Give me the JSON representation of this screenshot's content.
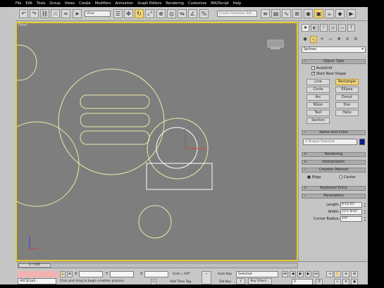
{
  "menu": {
    "items": [
      "File",
      "Edit",
      "Tools",
      "Group",
      "Views",
      "Create",
      "Modifiers",
      "Animation",
      "Graph Editors",
      "Rendering",
      "Customize",
      "MAXScript",
      "Help"
    ]
  },
  "toolbar": {
    "filter_select": "View",
    "selection_set_placeholder": "Create Selection Set"
  },
  "viewport": {
    "label": "Front",
    "border_color": "#e7cc2c",
    "shape_color": "#efe8a8",
    "selected_color": "#ffffff"
  },
  "command_panel": {
    "tabs": [
      "create-icon",
      "modify-icon",
      "hierarchy-icon",
      "motion-icon",
      "display-icon",
      "utilities-icon"
    ],
    "category_dropdown": "Splines",
    "object_type": {
      "title": "Object Type",
      "autogrid": "AutoGrid",
      "start_new_shape": "Start New Shape",
      "buttons": [
        "Line",
        "Rectangle",
        "Circle",
        "Ellipse",
        "Arc",
        "Donut",
        "NGon",
        "Star",
        "Text",
        "Helix",
        "Section"
      ],
      "active_button": "Rectangle"
    },
    "name_and_color": {
      "title": "Name and Color",
      "name_value": "2 Shapes Selected",
      "color": "#0b1d8f"
    },
    "rendering": {
      "title": "Rendering"
    },
    "interpolation": {
      "title": "Interpolation"
    },
    "creation_method": {
      "title": "Creation Method",
      "edge": "Edge",
      "center": "Center"
    },
    "keyboard_entry": {
      "title": "Keyboard Entry"
    },
    "parameters": {
      "title": "Parameters",
      "length_label": "Length:",
      "length_value": "9'10.25\"",
      "width_label": "Width:",
      "width_value": "23'1 9/32\"",
      "corner_label": "Corner Radius:",
      "corner_value": "2'0\""
    }
  },
  "status": {
    "time_slider": "0 / 100",
    "script_field": "AttCIJi1pS...",
    "prompt": "Click and drag to begin creation process",
    "x_label": "X",
    "y_label": "Y",
    "z_label": "Z",
    "grid": "Grid = 0'0\"",
    "add_time_tag": "Add Time Tag",
    "auto_key": "Auto Key",
    "set_key": "Set Key",
    "selected": "Selected",
    "key_filters": "Key Filters...",
    "frame": "0"
  }
}
